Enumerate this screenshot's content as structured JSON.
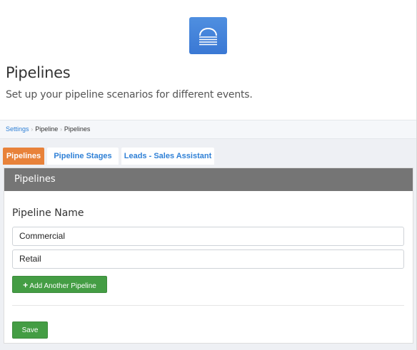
{
  "header": {
    "title": "Pipelines",
    "subtitle": "Set up your pipeline scenarios for different events.",
    "logo_icon": "cloud-logo-icon"
  },
  "breadcrumb": {
    "items": [
      "Settings",
      "Pipeline",
      "Pipelines"
    ]
  },
  "tabs": [
    {
      "label": "Pipelines",
      "active": true
    },
    {
      "label": "Pipeline Stages",
      "active": false
    },
    {
      "label": "Leads - Sales Assistant",
      "active": false
    }
  ],
  "panel": {
    "title": "Pipelines",
    "field_label": "Pipeline Name",
    "pipelines": [
      "Commercial",
      "Retail"
    ],
    "add_button": "Add Another Pipeline",
    "add_icon": "plus-icon",
    "save_button": "Save"
  },
  "colors": {
    "accent": "#e8823a",
    "link": "#2f80d6",
    "success": "#449d44",
    "panel_header": "#757575",
    "logo": "#3a78d4"
  }
}
